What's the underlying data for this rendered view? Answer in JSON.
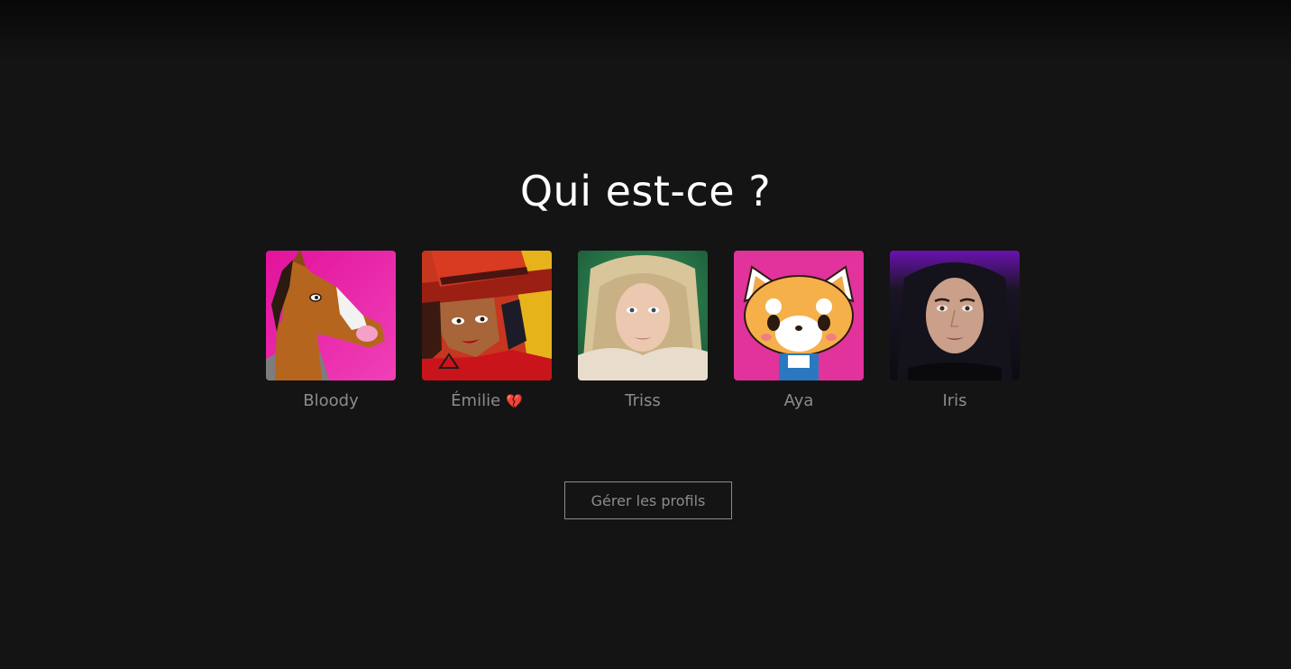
{
  "page": {
    "title": "Qui est-ce ?"
  },
  "profiles": [
    {
      "name": "Bloody",
      "suffix": "",
      "avatar_icon": "bojack-horse-avatar-icon",
      "avatar_bg": "#e20f9c"
    },
    {
      "name": "Émilie",
      "suffix": "💔",
      "avatar_icon": "red-hat-woman-avatar-icon",
      "avatar_bg": "#c7361f"
    },
    {
      "name": "Triss",
      "suffix": "",
      "avatar_icon": "blonde-woman-avatar-icon",
      "avatar_bg": "#2a8a55"
    },
    {
      "name": "Aya",
      "suffix": "",
      "avatar_icon": "red-panda-avatar-icon",
      "avatar_bg": "#e2329c"
    },
    {
      "name": "Iris",
      "suffix": "",
      "avatar_icon": "dark-haired-woman-avatar-icon",
      "avatar_bg": "#6a12b0"
    }
  ],
  "actions": {
    "manage_label": "Gérer les profils"
  },
  "colors": {
    "background": "#141414",
    "title": "#ffffff",
    "muted": "#8c8c8c"
  }
}
